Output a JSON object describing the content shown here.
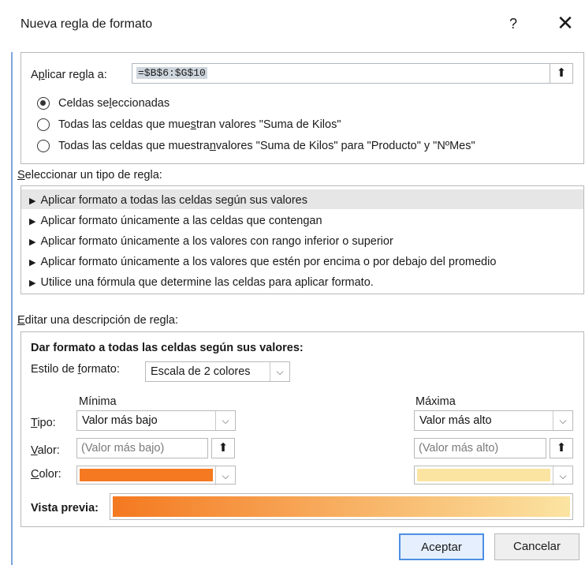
{
  "dialog": {
    "title": "Nueva regla de formato",
    "help": "?",
    "close": "✕"
  },
  "apply": {
    "label_prefix": "A",
    "label_underline": "p",
    "label_suffix": "licar regla a:",
    "range_value": "=$B$6:$G$10",
    "collapse_icon": "⬆"
  },
  "scope_options": [
    {
      "before": "Celdas se",
      "underline": "l",
      "after": "eccionadas",
      "selected": true
    },
    {
      "before": "Todas las celdas que mue",
      "underline": "s",
      "after": "tran valores \"Suma de Kilos\"",
      "selected": false
    },
    {
      "before": "Todas las celdas que muestra",
      "underline": "n",
      "after": " valores \"Suma de Kilos\" para \"Producto\" y \"NºMes\"",
      "selected": false
    }
  ],
  "rule_types": {
    "label_prefix": "",
    "label_underline": "S",
    "label_suffix": "eleccionar un tipo de regla:",
    "items": [
      "Aplicar formato a todas las celdas según sus valores",
      "Aplicar formato únicamente a las celdas que contengan",
      "Aplicar formato únicamente a los valores con rango inferior o superior",
      "Aplicar formato únicamente a los valores que estén por encima o por debajo del promedio",
      "Utilice una fórmula que determine las celdas para aplicar formato."
    ],
    "selected_index": 0
  },
  "description": {
    "label_prefix": "",
    "label_underline": "E",
    "label_suffix": "ditar una descripción de regla:",
    "heading": "Dar formato a todas las celdas según sus valores:",
    "style_label_prefix": "Estilo de ",
    "style_label_underline": "f",
    "style_label_suffix": "ormato:",
    "style_value": "Escala de 2 colores",
    "minimum_label": "Mínima",
    "maximum_label": "Máxima",
    "type_label_underline": "T",
    "type_label_suffix": "ipo:",
    "value_label_underline": "V",
    "value_label_suffix": "alor:",
    "color_label_underline": "C",
    "color_label_suffix": "olor:",
    "minimum_type": "Valor más bajo",
    "maximum_type": "Valor más alto",
    "minimum_value_placeholder": "(Valor más bajo)",
    "maximum_value_placeholder": "(Valor más alto)",
    "minimum_color": "#F47920",
    "maximum_color": "#FBE4A2",
    "preview_label": "Vista previa:"
  },
  "buttons": {
    "accept": "Aceptar",
    "cancel": "Cancelar"
  },
  "icons": {
    "collapse": "upload-arrow-icon",
    "caret": "chevron-down-icon",
    "close": "close-icon",
    "help": "help-icon",
    "rule_marker": "triangle-right-icon"
  }
}
